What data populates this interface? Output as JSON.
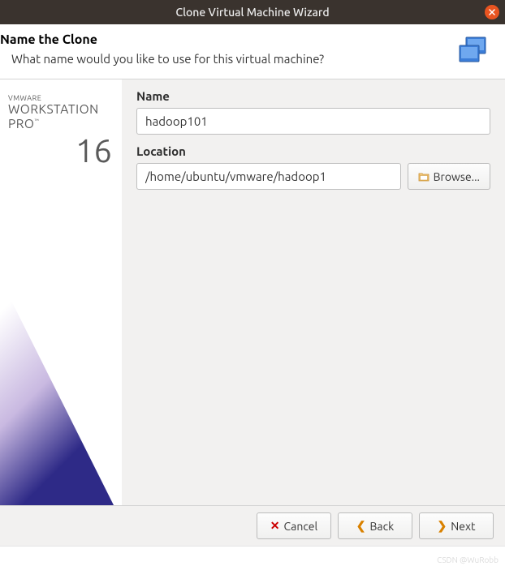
{
  "titlebar": {
    "title": "Clone Virtual Machine Wizard"
  },
  "header": {
    "heading": "Name the Clone",
    "subtext": "What name would you like to use for this virtual machine?"
  },
  "branding": {
    "vmware": "VMWARE",
    "workstation": "WORKSTATION",
    "pro": "PRO",
    "version": "16"
  },
  "form": {
    "name_label": "Name",
    "name_value": "hadoop101",
    "location_label": "Location",
    "location_value": "/home/ubuntu/vmware/hadoop1",
    "browse_label": "Browse..."
  },
  "footer": {
    "cancel": "Cancel",
    "back": "Back",
    "next": "Next"
  },
  "watermark": "CSDN @WuRobb"
}
